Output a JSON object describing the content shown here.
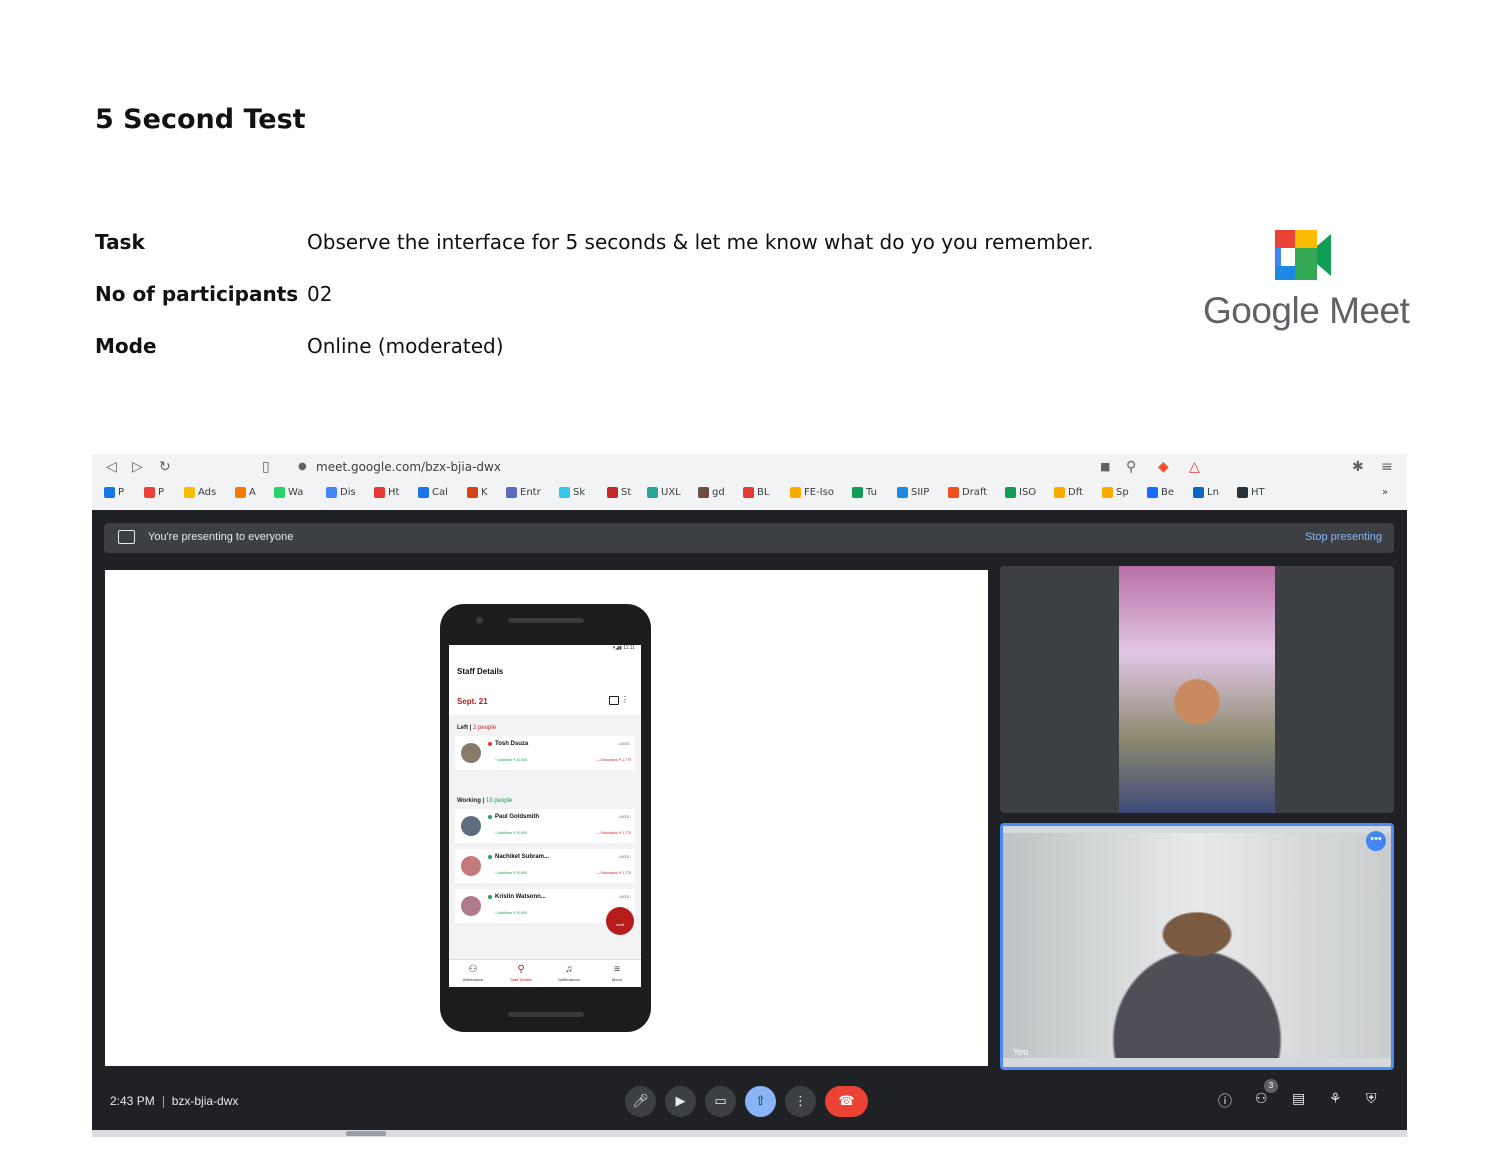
{
  "doc": {
    "title": "5 Second Test",
    "task_label": "Task",
    "task_value": "Observe the interface for 5 seconds & let me know what do yo you remember.",
    "participants_label": "No of participants",
    "participants_value": "02",
    "mode_label": "Mode",
    "mode_value": "Online (moderated)",
    "logo_text": "Google Meet"
  },
  "browser": {
    "url": "meet.google.com/bzx-bjia-dwx",
    "bookmarks": [
      "P",
      "P",
      "Ads",
      "A",
      "Wa",
      "Dis",
      "Ht",
      "Cal",
      "K",
      "Entr",
      "Sk",
      "St",
      "UXL",
      "gd",
      "BL",
      "FE-Iso",
      "Tu",
      "SIIP",
      "Draft",
      "ISO",
      "Dft",
      "Sp",
      "Be",
      "Ln",
      "HT"
    ],
    "bookmark_colors": [
      "#1a73e8",
      "#ea4335",
      "#fbbc04",
      "#f57c00",
      "#25d366",
      "#4285f4",
      "#e53935",
      "#1a73e8",
      "#d84315",
      "#5c6bc0",
      "#36c5f0",
      "#c62828",
      "#26a69a",
      "#6d4c41",
      "#e53935",
      "#f9ab00",
      "#0f9d58",
      "#1e88e5",
      "#f24e1e",
      "#0f9d58",
      "#f9ab00",
      "#f9ab00",
      "#1769ff",
      "#0a66c2",
      "#263238"
    ],
    "more": "»"
  },
  "meet": {
    "presenting_text": "You're presenting to everyone",
    "stop_presenting": "Stop presenting",
    "time": "2:43 PM",
    "meeting_code": "bzx-bjia-dwx",
    "people_count": "3",
    "self_label": "You"
  },
  "app": {
    "status_time": "11:11",
    "title": "Staff Details",
    "date": "Sept. 21",
    "left_label": "Left |",
    "left_count": "2 people",
    "working_label": "Working |",
    "working_count": "13 people",
    "staff": [
      {
        "name": "Tosh Dsuza",
        "id": "10001",
        "status": "left"
      },
      {
        "name": "Paul Goldsmith",
        "id": "10001",
        "status": "working"
      },
      {
        "name": "Nachiket Subram...",
        "id": "10001",
        "status": "working"
      },
      {
        "name": "Kristin Watsonn...",
        "id": "10001",
        "status": "working"
      }
    ],
    "additions": "+ Additions  ₹ 20,000",
    "deductions": "— Deductions  ₹ 1,775",
    "fab_label": "staff",
    "tabs": [
      "Attendance",
      "Staff Details",
      "Notifications",
      "Menu"
    ]
  }
}
